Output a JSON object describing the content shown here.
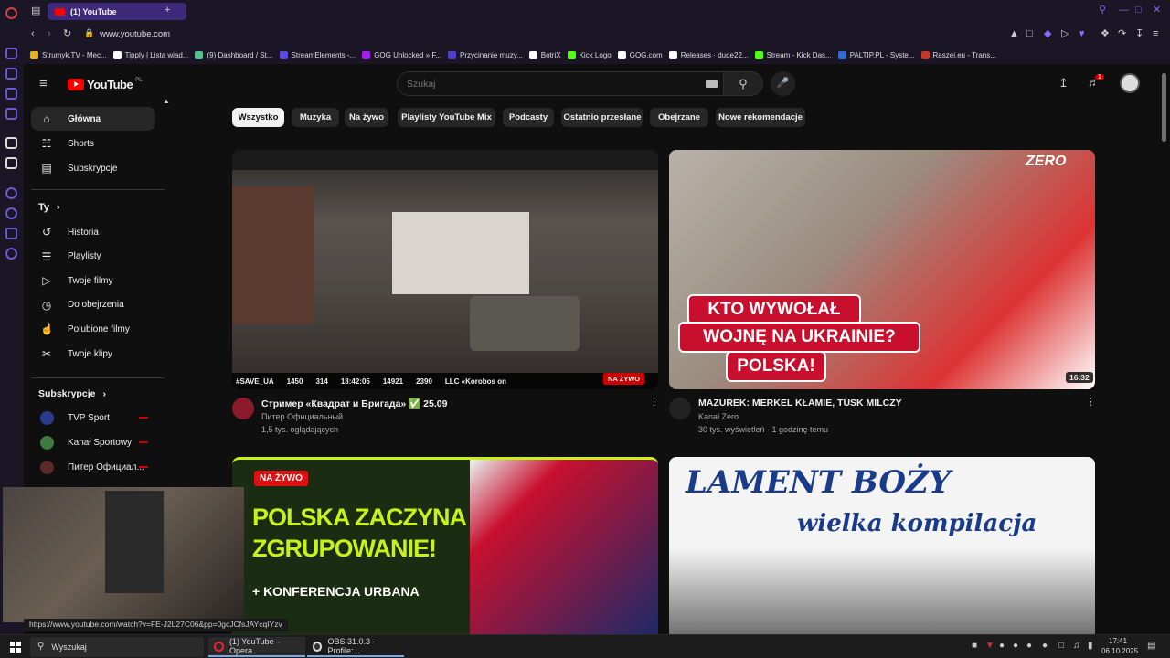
{
  "browser": {
    "tab_title": "(1) YouTube",
    "url": "www.youtube.com",
    "bookmarks": [
      {
        "label": "Strumyk.TV - Mec...",
        "color": "#e6b31e"
      },
      {
        "label": "Tipply | Lista wiad...",
        "color": "#ffffff"
      },
      {
        "label": "(9) Dashboard / St...",
        "color": "#53c58b"
      },
      {
        "label": "StreamElements -...",
        "color": "#5b4bdb"
      },
      {
        "label": "GOG Unlocked » F...",
        "color": "#a020f0"
      },
      {
        "label": "Przycinanie muzy...",
        "color": "#4f3fc4"
      },
      {
        "label": "BotriX",
        "color": "#ffffff"
      },
      {
        "label": "Kick Logo",
        "color": "#53fc18"
      },
      {
        "label": "GOG.com",
        "color": "#ffffff"
      },
      {
        "label": "Releases · dude22...",
        "color": "#ffffff"
      },
      {
        "label": "Stream - Kick Das...",
        "color": "#53fc18"
      },
      {
        "label": "PALTIP.PL - Syste...",
        "color": "#2d6bd6"
      },
      {
        "label": "Raszei.eu - Trans...",
        "color": "#c0392b"
      }
    ],
    "status_url": "https://www.youtube.com/watch?v=FE-J2L27C06&pp=0gcJCfsJAYcqIYzv"
  },
  "youtube": {
    "logo_text": "YouTube",
    "logo_region": "PL",
    "search_placeholder": "Szukaj",
    "notification_count": "1",
    "sidebar": {
      "main": [
        {
          "label": "Główna",
          "icon": "home-icon",
          "glyph": "⌂",
          "active": true
        },
        {
          "label": "Shorts",
          "icon": "shorts-icon",
          "glyph": "☵"
        },
        {
          "label": "Subskrypcje",
          "icon": "subscriptions-icon",
          "glyph": "▤"
        }
      ],
      "you_header": "Ty",
      "you": [
        {
          "label": "Historia",
          "icon": "history-icon",
          "glyph": "↺"
        },
        {
          "label": "Playlisty",
          "icon": "playlists-icon",
          "glyph": "☰"
        },
        {
          "label": "Twoje filmy",
          "icon": "your-videos-icon",
          "glyph": "▷"
        },
        {
          "label": "Do obejrzenia",
          "icon": "watch-later-icon",
          "glyph": "◷"
        },
        {
          "label": "Polubione filmy",
          "icon": "liked-icon",
          "glyph": "☝"
        },
        {
          "label": "Twoje klipy",
          "icon": "clips-icon",
          "glyph": "✂"
        }
      ],
      "subs_header": "Subskrypcje",
      "subs": [
        {
          "label": "TVP Sport",
          "color": "#2a3b8f"
        },
        {
          "label": "Kanał Sportowy",
          "color": "#3e7b3e"
        },
        {
          "label": "Питер Официал..."
        }
      ]
    },
    "chips": [
      "Wszystko",
      "Muzyka",
      "Na żywo",
      "Playlisty YouTube Mix",
      "Podcasty",
      "Ostatnio przesłane",
      "Obejrzane",
      "Nowe rekomendacje"
    ],
    "videos": [
      {
        "title": "Стример «Квадрат и Бригада» ✅ 25.09",
        "channel": "Питер Официальный",
        "meta": "1,5 tys. oglądających",
        "badge": "NA ŻYWO",
        "overlay_stats": [
          "#SAVE_UA",
          "1450",
          "314",
          "18:42:05",
          "14921",
          "2390",
          "LLC «Korobos on"
        ]
      },
      {
        "title": "MAZUREK: MERKEL KŁAMIE, TUSK MILCZY",
        "channel": "Kanał Zero",
        "meta": "30 tys. wyświetleń · 1 godzinę temu",
        "duration": "16:32",
        "thumb_lines": [
          "KTO WYWOŁAŁ",
          "WOJNĘ NA UKRAINIE?",
          "POLSKA!"
        ],
        "brand": "ZERO"
      },
      {
        "thumb_badge": "NA ŻYWO",
        "thumb_lines": [
          "POLSKA ZACZYNA",
          "ZGRUPOWANIE!",
          "+ KONFERENCJA URBANA"
        ]
      },
      {
        "thumb_lines": [
          "LAMENT BOŻY",
          "wielka kompilacja"
        ]
      }
    ]
  },
  "taskbar": {
    "search_label": "Wyszukaj",
    "apps": [
      "(1) YouTube – Opera",
      "OBS 31.0.3 - Profile:..."
    ],
    "time": "17:41",
    "date": "06.10.2025"
  }
}
